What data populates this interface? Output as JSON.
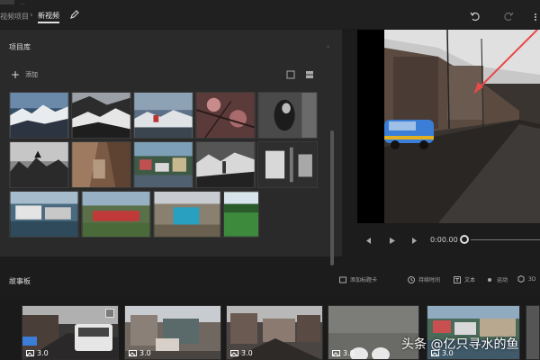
{
  "header": {
    "remnant_text": "...",
    "crumb_prev": "视频项目",
    "crumb_sep": "›",
    "crumb_current": "新视频"
  },
  "library": {
    "title": "项目库",
    "collapse": "‹",
    "add_label": "添加",
    "add_plus": "+"
  },
  "preview": {
    "time": "0:00.00"
  },
  "storyboard": {
    "title": "故事板",
    "tools": [
      {
        "label": "添加标题卡",
        "icon": "title-card-icon"
      },
      {
        "label": "持续时间",
        "icon": "clock-icon"
      },
      {
        "label": "文本",
        "icon": "text-icon"
      },
      {
        "label": "运动",
        "icon": "motion-icon"
      },
      {
        "label": "3D",
        "icon": "3d-icon"
      }
    ],
    "clips": [
      {
        "duration": "3.0"
      },
      {
        "duration": "3.0"
      },
      {
        "duration": "3.0"
      },
      {
        "duration": "3.0"
      },
      {
        "duration": "3.0"
      }
    ]
  },
  "watermark": "头条 @亿只寻水的鱼",
  "colors": {
    "background": "#1c1c1c",
    "panel": "#2a2a2a",
    "arrow": "#e84a4a",
    "taxi": "#3b7ed8"
  }
}
